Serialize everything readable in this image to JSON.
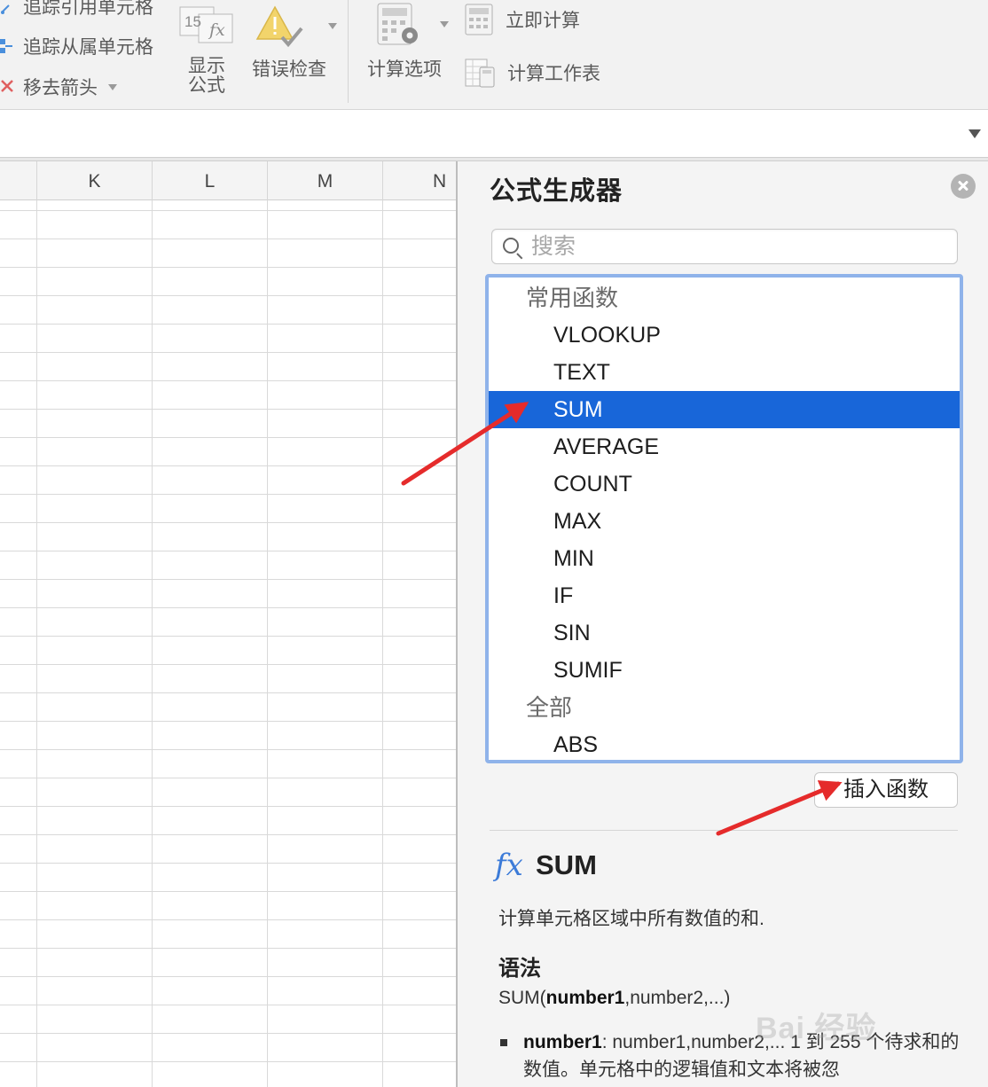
{
  "ribbon": {
    "trace_precedents": "追踪引用单元格",
    "trace_dependents": "追踪从属单元格",
    "remove_arrows": "移去箭头",
    "show_formulas_line1": "显示",
    "show_formulas_line2": "公式",
    "show_formulas_icon_number": "15",
    "show_formulas_icon_fx": "fx",
    "error_checking": "错误检查",
    "calc_options": "计算选项",
    "calc_now": "立即计算",
    "calc_sheet": "计算工作表"
  },
  "sheet": {
    "columns": [
      "K",
      "L",
      "M",
      "N"
    ]
  },
  "formula_builder": {
    "title": "公式生成器",
    "search_placeholder": "搜索",
    "categories": [
      {
        "label": "常用函数",
        "items": [
          "VLOOKUP",
          "TEXT",
          "SUM",
          "AVERAGE",
          "COUNT",
          "MAX",
          "MIN",
          "IF",
          "SIN",
          "SUMIF"
        ]
      },
      {
        "label": "全部",
        "items": [
          "ABS"
        ]
      }
    ],
    "selected": "SUM",
    "insert_button": "插入函数",
    "detail": {
      "fx_symbol": "fx",
      "name": "SUM",
      "description": "计算单元格区域中所有数值的和.",
      "syntax_title": "语法",
      "syntax_prefix": "SUM(",
      "syntax_bold": "number1",
      "syntax_suffix": ",number2,...)",
      "arg_name": "number1",
      "arg_text": ": number1,number2,... 1 到 255 个待求和的数值。单元格中的逻辑值和文本将被忽"
    }
  },
  "watermark": "Bai 经验",
  "colors": {
    "selection": "#1866d9",
    "list_border": "#8fb3ea",
    "annotation_arrow": "#e52b2b",
    "fx_blue": "#3c7bd8"
  }
}
